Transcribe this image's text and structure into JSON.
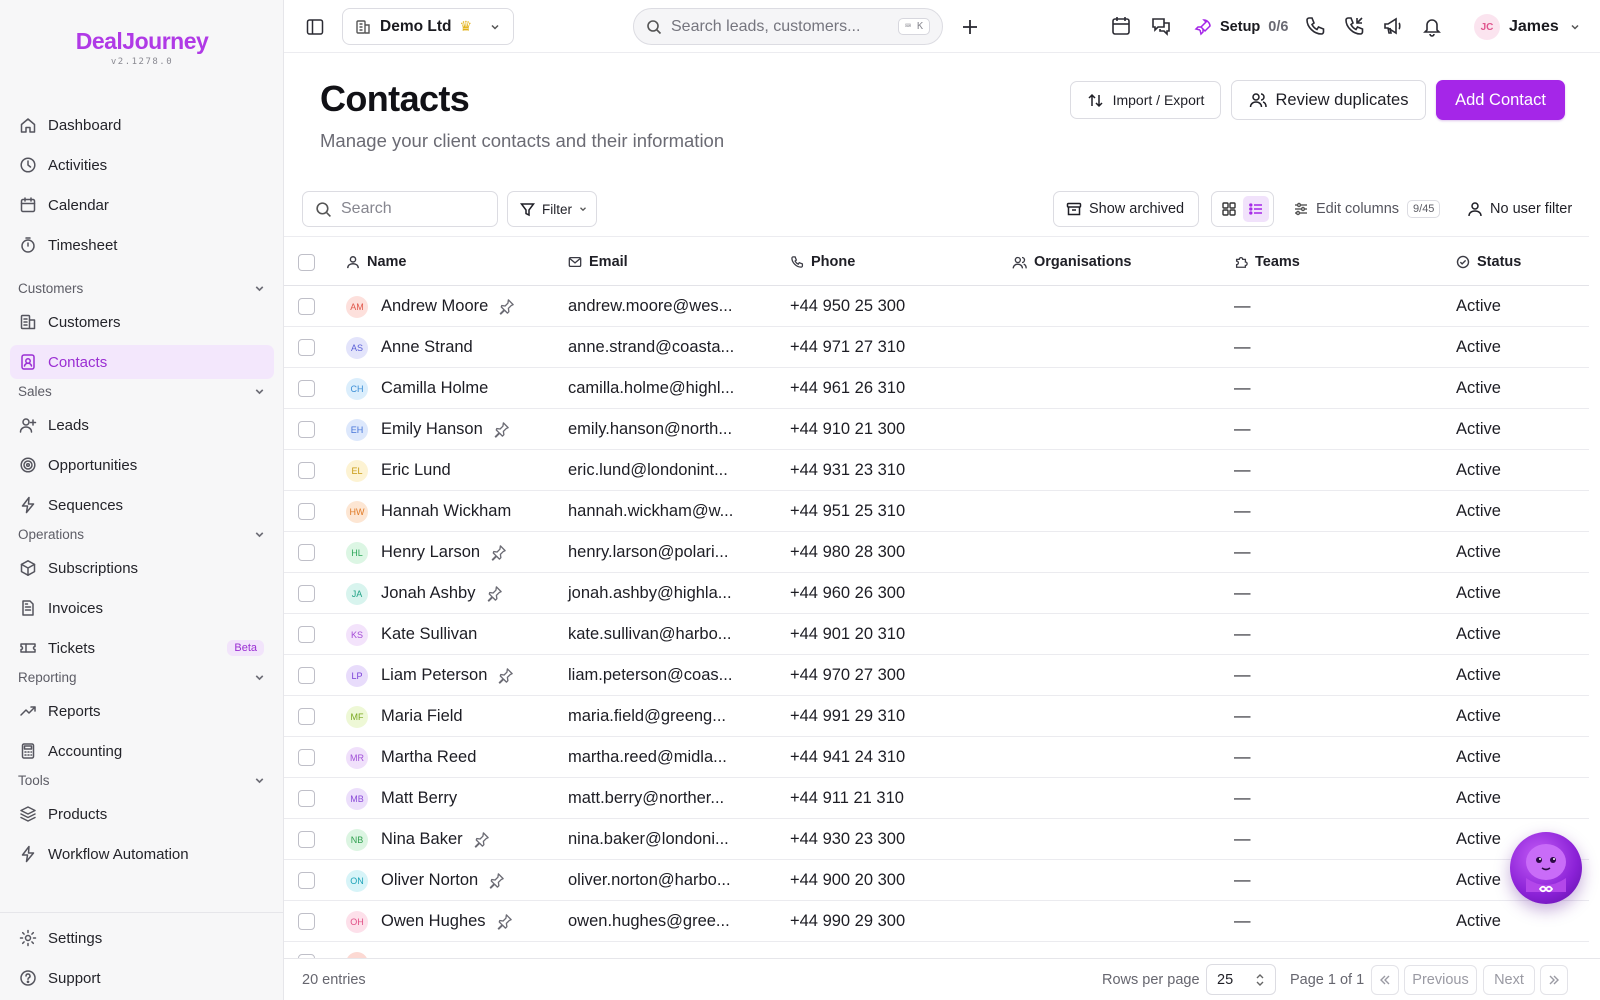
{
  "app": {
    "logo_text": "DealJourney",
    "version": "v2.1278.0"
  },
  "sidebar": {
    "top_items": [
      {
        "label": "Dashboard",
        "icon": "home-icon"
      },
      {
        "label": "Activities",
        "icon": "clock-icon"
      },
      {
        "label": "Calendar",
        "icon": "calendar-icon"
      },
      {
        "label": "Timesheet",
        "icon": "stopwatch-icon"
      }
    ],
    "groups": [
      {
        "label": "Customers",
        "items": [
          {
            "label": "Customers",
            "icon": "building-icon"
          },
          {
            "label": "Contacts",
            "icon": "contact-card-icon",
            "active": true
          }
        ]
      },
      {
        "label": "Sales",
        "items": [
          {
            "label": "Leads",
            "icon": "user-plus-icon"
          },
          {
            "label": "Opportunities",
            "icon": "target-icon"
          },
          {
            "label": "Sequences",
            "icon": "lightning-icon"
          }
        ]
      },
      {
        "label": "Operations",
        "items": [
          {
            "label": "Subscriptions",
            "icon": "box-icon"
          },
          {
            "label": "Invoices",
            "icon": "document-icon"
          },
          {
            "label": "Tickets",
            "icon": "ticket-icon",
            "badge": "Beta"
          }
        ]
      },
      {
        "label": "Reporting",
        "items": [
          {
            "label": "Reports",
            "icon": "trend-icon"
          },
          {
            "label": "Accounting",
            "icon": "calculator-icon"
          }
        ]
      },
      {
        "label": "Tools",
        "items": [
          {
            "label": "Products",
            "icon": "layers-icon"
          },
          {
            "label": "Workflow Automation",
            "icon": "lightning-icon"
          }
        ]
      }
    ],
    "bottom_items": [
      {
        "label": "Settings",
        "icon": "gear-icon"
      },
      {
        "label": "Support",
        "icon": "help-icon"
      }
    ]
  },
  "topbar": {
    "company": "Demo Ltd",
    "search_placeholder": "Search leads, customers...",
    "search_shortcut": "⌨ K",
    "setup_label": "Setup",
    "setup_count": "0/6",
    "user_initials": "JC",
    "user_name": "James"
  },
  "header": {
    "title": "Contacts",
    "subtitle": "Manage your client contacts and their information",
    "import_export": "Import / Export",
    "review_duplicates": "Review duplicates",
    "add_contact": "Add Contact"
  },
  "toolbar": {
    "search_placeholder": "Search",
    "filter": "Filter",
    "show_archived": "Show archived",
    "edit_columns": "Edit columns",
    "columns_count": "9/45",
    "user_filter": "No user filter"
  },
  "table": {
    "columns": [
      "Name",
      "Email",
      "Phone",
      "Organisations",
      "Teams",
      "Status"
    ],
    "rows": [
      {
        "initials": "AM",
        "name": "Andrew Moore",
        "pinned": true,
        "email": "andrew.moore@wes...",
        "phone": "+44 950 25 300",
        "org": "",
        "teams": "—",
        "status": "Active",
        "av_bg": "#fde0dc",
        "av_fg": "#e0574a"
      },
      {
        "initials": "AS",
        "name": "Anne Strand",
        "pinned": false,
        "email": "anne.strand@coasta...",
        "phone": "+44 971 27 310",
        "org": "",
        "teams": "—",
        "status": "Active",
        "av_bg": "#e3e4fb",
        "av_fg": "#5a5fd6"
      },
      {
        "initials": "CH",
        "name": "Camilla Holme",
        "pinned": false,
        "email": "camilla.holme@highl...",
        "phone": "+44 961 26 310",
        "org": "",
        "teams": "—",
        "status": "Active",
        "av_bg": "#dbeefc",
        "av_fg": "#3b8ed6"
      },
      {
        "initials": "EH",
        "name": "Emily Hanson",
        "pinned": true,
        "email": "emily.hanson@north...",
        "phone": "+44 910 21 300",
        "org": "",
        "teams": "—",
        "status": "Active",
        "av_bg": "#dde8fc",
        "av_fg": "#4574d8"
      },
      {
        "initials": "EL",
        "name": "Eric Lund",
        "pinned": false,
        "email": "eric.lund@londonint...",
        "phone": "+44 931 23 310",
        "org": "",
        "teams": "—",
        "status": "Active",
        "av_bg": "#fdf3d3",
        "av_fg": "#c79a12"
      },
      {
        "initials": "HW",
        "name": "Hannah Wickham",
        "pinned": false,
        "email": "hannah.wickham@w...",
        "phone": "+44 951 25 310",
        "org": "",
        "teams": "—",
        "status": "Active",
        "av_bg": "#fde6d3",
        "av_fg": "#e07a26"
      },
      {
        "initials": "HL",
        "name": "Henry Larson",
        "pinned": true,
        "email": "henry.larson@polari...",
        "phone": "+44 980 28 300",
        "org": "",
        "teams": "—",
        "status": "Active",
        "av_bg": "#dcf6e4",
        "av_fg": "#2ea85a"
      },
      {
        "initials": "JA",
        "name": "Jonah Ashby",
        "pinned": true,
        "email": "jonah.ashby@highla...",
        "phone": "+44 960 26 300",
        "org": "",
        "teams": "—",
        "status": "Active",
        "av_bg": "#d8f4ee",
        "av_fg": "#21a287"
      },
      {
        "initials": "KS",
        "name": "Kate Sullivan",
        "pinned": false,
        "email": "kate.sullivan@harbo...",
        "phone": "+44 901 20 310",
        "org": "",
        "teams": "—",
        "status": "Active",
        "av_bg": "#f3e3fb",
        "av_fg": "#a44ad6"
      },
      {
        "initials": "LP",
        "name": "Liam Peterson",
        "pinned": true,
        "email": "liam.peterson@coas...",
        "phone": "+44 970 27 300",
        "org": "",
        "teams": "—",
        "status": "Active",
        "av_bg": "#e8dcfb",
        "av_fg": "#7a3fd8"
      },
      {
        "initials": "MF",
        "name": "Maria Field",
        "pinned": false,
        "email": "maria.field@greeng...",
        "phone": "+44 991 29 310",
        "org": "",
        "teams": "—",
        "status": "Active",
        "av_bg": "#eef8d6",
        "av_fg": "#7aa820"
      },
      {
        "initials": "MR",
        "name": "Martha Reed",
        "pinned": false,
        "email": "martha.reed@midla...",
        "phone": "+44 941 24 310",
        "org": "",
        "teams": "—",
        "status": "Active",
        "av_bg": "#f0e0fb",
        "av_fg": "#a151d8"
      },
      {
        "initials": "MB",
        "name": "Matt Berry",
        "pinned": false,
        "email": "matt.berry@norther...",
        "phone": "+44 911 21 310",
        "org": "",
        "teams": "—",
        "status": "Active",
        "av_bg": "#ecdffb",
        "av_fg": "#8a4ad8"
      },
      {
        "initials": "NB",
        "name": "Nina Baker",
        "pinned": true,
        "email": "nina.baker@londoni...",
        "phone": "+44 930 23 300",
        "org": "",
        "teams": "—",
        "status": "Active",
        "av_bg": "#dcf5e2",
        "av_fg": "#2fa04f"
      },
      {
        "initials": "ON",
        "name": "Oliver Norton",
        "pinned": true,
        "email": "oliver.norton@harbo...",
        "phone": "+44 900 20 300",
        "org": "",
        "teams": "—",
        "status": "Active",
        "av_bg": "#d7f4f8",
        "av_fg": "#1ea3b8"
      },
      {
        "initials": "OH",
        "name": "Owen Hughes",
        "pinned": true,
        "email": "owen.hughes@gree...",
        "phone": "+44 990 29 300",
        "org": "",
        "teams": "—",
        "status": "Active",
        "av_bg": "#fde0ea",
        "av_fg": "#e04f86"
      },
      {
        "initials": "",
        "name": "",
        "pinned": false,
        "email": "",
        "phone": "",
        "org": "",
        "teams": "",
        "status": "",
        "av_bg": "#fcd9d3",
        "av_fg": "#e05a4a"
      }
    ]
  },
  "footer": {
    "entries": "20 entries",
    "rows_per_page_label": "Rows per page",
    "rows_per_page": "25",
    "page_info": "Page 1 of 1",
    "previous": "Previous",
    "next": "Next"
  },
  "colors": {
    "accent": "#a526e8",
    "active_nav_bg": "#f3e7fc"
  }
}
